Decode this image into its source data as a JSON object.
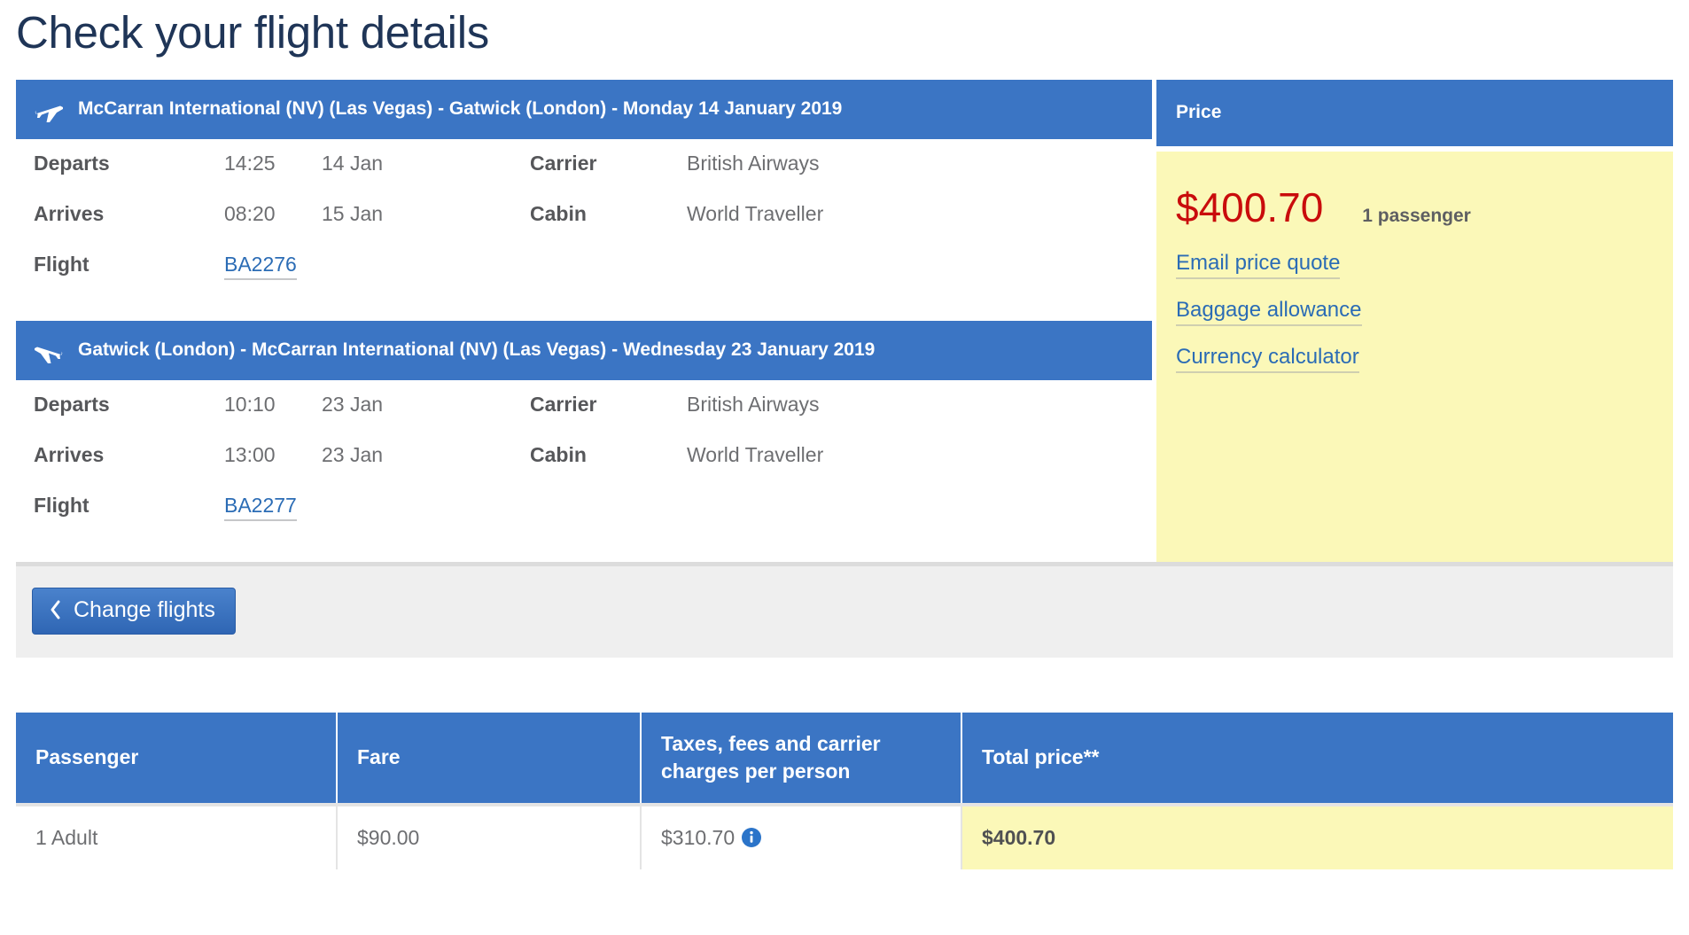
{
  "page": {
    "title": "Check your flight details"
  },
  "flights": [
    {
      "icon": "plane-depart-icon",
      "header": "McCarran International (NV) (Las Vegas) - Gatwick (London) - Monday 14 January 2019",
      "departs_label": "Departs",
      "departs_time": "14:25",
      "departs_date": "14 Jan",
      "arrives_label": "Arrives",
      "arrives_time": "08:20",
      "arrives_date": "15 Jan",
      "flight_label": "Flight",
      "flight_number": "BA2276",
      "carrier_label": "Carrier",
      "carrier_value": "British Airways",
      "cabin_label": "Cabin",
      "cabin_value": "World Traveller"
    },
    {
      "icon": "plane-arrive-icon",
      "header": "Gatwick (London) - McCarran International (NV) (Las Vegas) - Wednesday 23 January 2019",
      "departs_label": "Departs",
      "departs_time": "10:10",
      "departs_date": "23 Jan",
      "arrives_label": "Arrives",
      "arrives_time": "13:00",
      "arrives_date": "23 Jan",
      "flight_label": "Flight",
      "flight_number": "BA2277",
      "carrier_label": "Carrier",
      "carrier_value": "British Airways",
      "cabin_label": "Cabin",
      "cabin_value": "World Traveller"
    }
  ],
  "price_panel": {
    "header": "Price",
    "amount": "$400.70",
    "passengers": "1 passenger",
    "links": [
      "Email price quote",
      "Baggage allowance",
      "Currency calculator"
    ]
  },
  "actions": {
    "change_flights_label": "Change flights"
  },
  "fare_table": {
    "headers": [
      "Passenger",
      "Fare",
      "Taxes, fees and carrier charges per person",
      "Total price**"
    ],
    "rows": [
      {
        "passenger": "1 Adult",
        "fare": "$90.00",
        "taxes": "$310.70",
        "total": "$400.70"
      }
    ]
  },
  "colors": {
    "brand_blue": "#3b75c4",
    "price_red": "#c90c0c",
    "highlight_yellow": "#fbf8b8",
    "link_blue": "#2b6cb5",
    "title_navy": "#1f3557"
  }
}
